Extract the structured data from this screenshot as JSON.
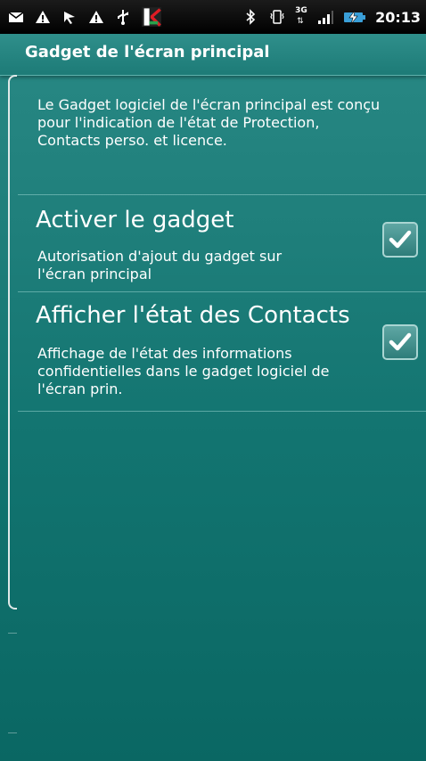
{
  "status_bar": {
    "time": "20:13",
    "network": "3G",
    "left_icons": [
      "mail-icon",
      "warning-icon",
      "sync-icon",
      "warning-icon",
      "usb-icon",
      "kaspersky-icon"
    ],
    "right_icons": [
      "bluetooth-icon",
      "vibrate-icon",
      "network-3g-icon",
      "signal-icon",
      "battery-charging-icon"
    ]
  },
  "header": {
    "title": "Gadget de l'écran principal"
  },
  "description": "Le Gadget logiciel de l'écran principal est conçu\npour l'indication de l'état de Protection,\nContacts perso. et licence.",
  "preferences": [
    {
      "title": "Activer le gadget",
      "summary": "Autorisation d'ajout du gadget sur\nl'écran principal",
      "checked": true
    },
    {
      "title": "Afficher l'état des Contacts",
      "summary": "Affichage de l'état des informations\nconfidentielles dans le gadget logiciel de\nl'écran prin.",
      "checked": true
    }
  ],
  "colors": {
    "accent": "#1d7b77",
    "checkmark": "#ffffff"
  }
}
